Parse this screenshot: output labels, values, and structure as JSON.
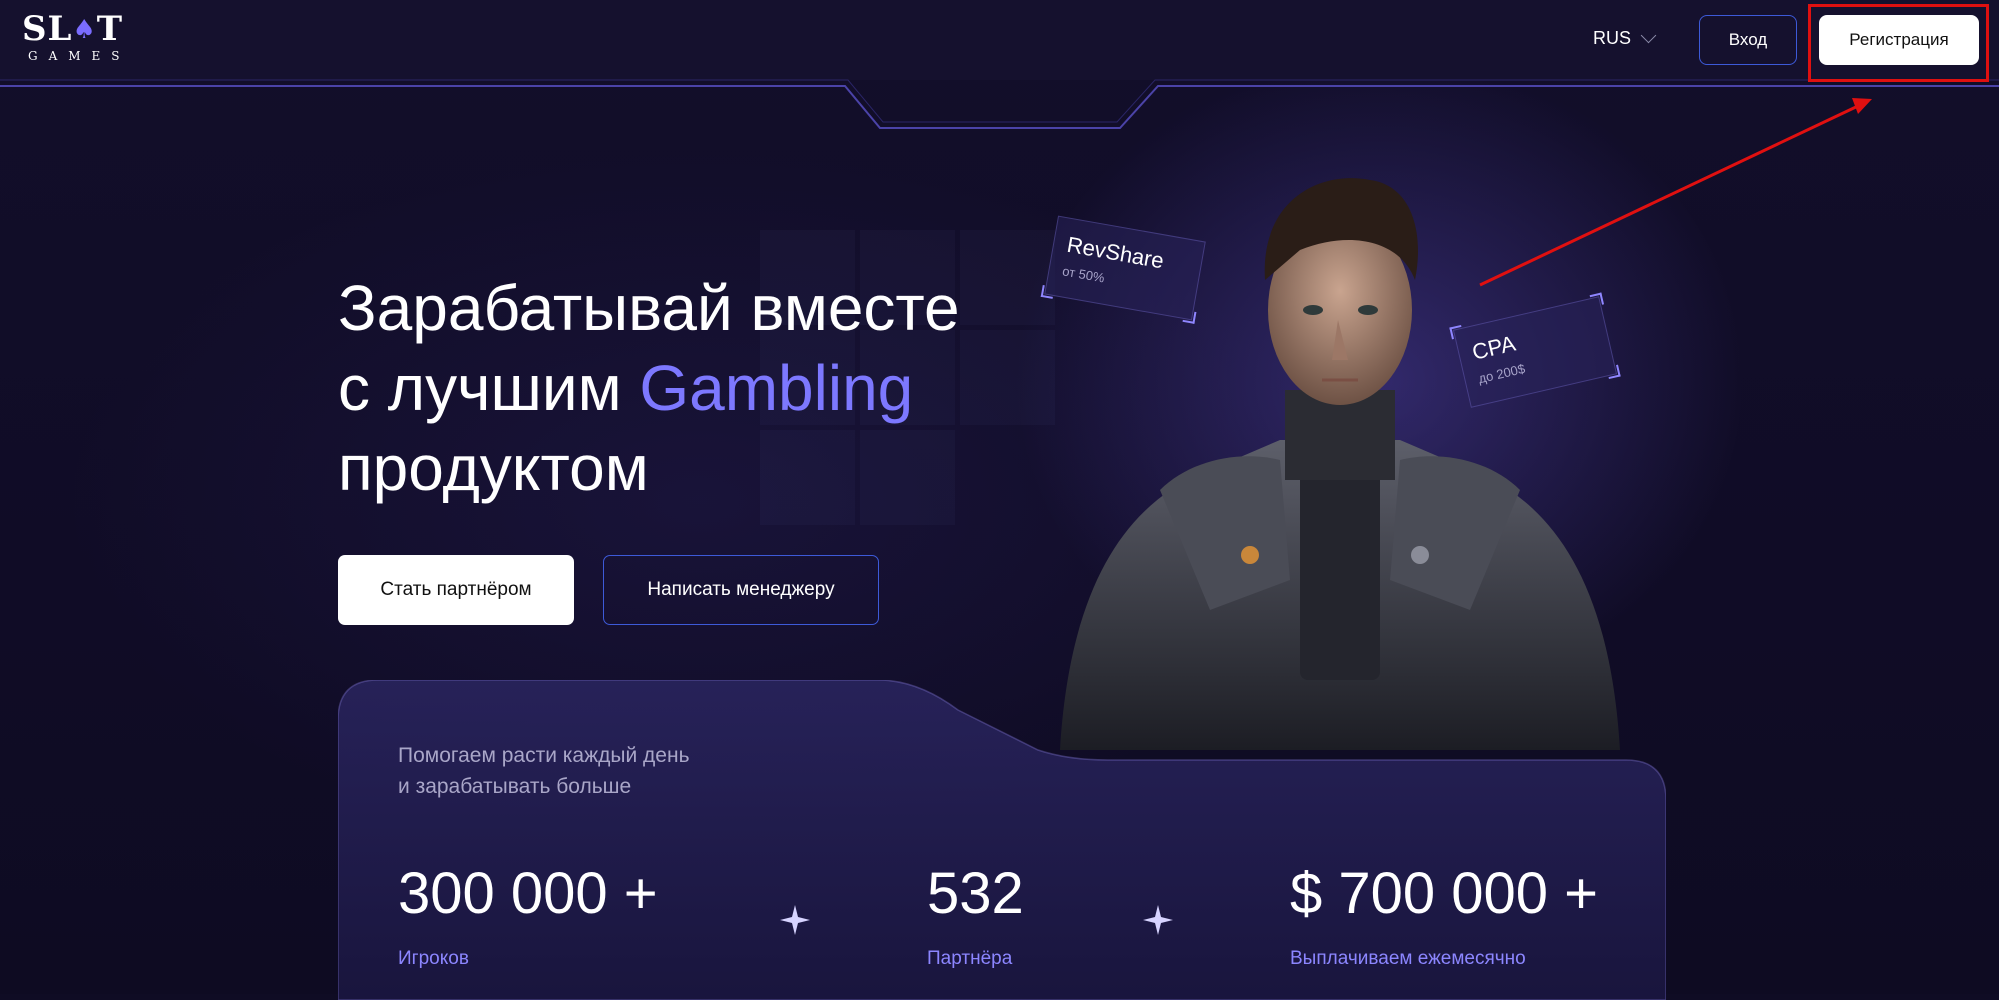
{
  "header": {
    "logo_top": "SLOT",
    "logo_bottom": "GAMES",
    "language": "RUS",
    "login_label": "Вход",
    "register_label": "Регистрация"
  },
  "hero": {
    "title_line1": "Зарабатывай вместе",
    "title_line2_prefix": "с лучшим ",
    "title_accent": "Gambling",
    "title_line3": "продуктом",
    "partner_button": "Стать партнёром",
    "manager_button": "Написать менеджеру"
  },
  "cards": {
    "revshare_title": "RevShare",
    "revshare_sub": "от 50%",
    "cpa_title": "CPA",
    "cpa_sub": "до 200$"
  },
  "stats": {
    "subtitle_line1": "Помогаем расти каждый день",
    "subtitle_line2": "и зарабатывать больше",
    "items": [
      {
        "value": "300 000 +",
        "label": "Игроков"
      },
      {
        "value": "532",
        "label": "Партнёра"
      },
      {
        "value": "$ 700 000 +",
        "label": "Выплачиваем ежемесячно"
      }
    ]
  },
  "colors": {
    "accent": "#7d78ff",
    "button_border": "#3d5ad8",
    "highlight": "#e01010"
  }
}
